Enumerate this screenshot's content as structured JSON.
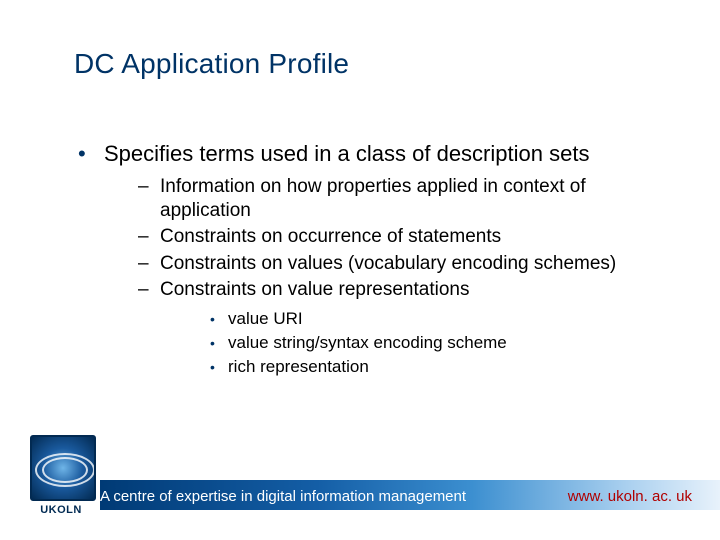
{
  "title": "DC Application Profile",
  "bullet": "Specifies terms used in a class of description sets",
  "sub": [
    "Information on how properties applied in context of application",
    "Constraints on occurrence of statements",
    "Constraints on values (vocabulary encoding schemes)",
    "Constraints on value representations"
  ],
  "subsub": [
    "value URI",
    "value string/syntax encoding scheme",
    "rich representation"
  ],
  "footer_text": "A centre of expertise in digital information management",
  "footer_url": "www. ukoln. ac. uk",
  "logo_name": "UKOLN"
}
